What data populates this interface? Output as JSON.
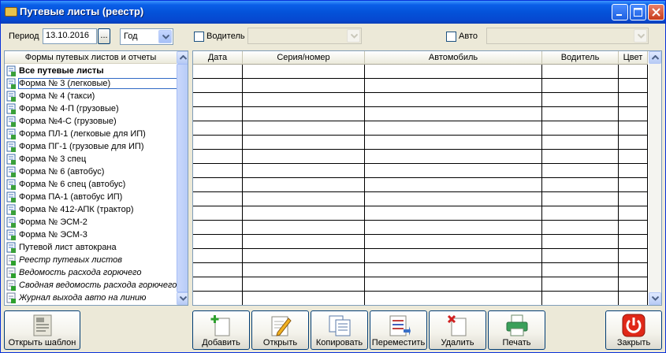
{
  "window": {
    "title": "Путевые листы (реестр)"
  },
  "filters": {
    "period_label": "Период",
    "date_value": "13.10.2016",
    "dots_label": "...",
    "period_type_value": "Год",
    "driver_label": "Водитель",
    "driver_value": "",
    "auto_label": "Авто",
    "auto_value": ""
  },
  "left_panel": {
    "header": "Формы путевых листов и отчеты",
    "items": [
      {
        "label": "Все путевые листы"
      },
      {
        "label": "Форма № 3 (легковые)"
      },
      {
        "label": "Форма № 4 (такси)"
      },
      {
        "label": "Форма № 4-П (грузовые)"
      },
      {
        "label": "Форма №4-С (грузовые)"
      },
      {
        "label": "Форма ПЛ-1 (легковые для ИП)"
      },
      {
        "label": "Форма ПГ-1 (грузовые для ИП)"
      },
      {
        "label": "Форма № 3 спец"
      },
      {
        "label": "Форма № 6 (автобус)"
      },
      {
        "label": "Форма № 6 спец (автобус)"
      },
      {
        "label": "Форма ПА-1 (автобус ИП)"
      },
      {
        "label": "Форма № 412-АПК (трактор)"
      },
      {
        "label": "Форма № ЭСМ-2"
      },
      {
        "label": "Форма № ЭСМ-3"
      },
      {
        "label": "Путевой лист автокрана"
      },
      {
        "label": "Реестр путевых листов"
      },
      {
        "label": "Ведомость расхода горючего"
      },
      {
        "label": "Сводная ведомость расхода горючего"
      },
      {
        "label": "Журнал выхода авто на линию"
      }
    ]
  },
  "grid": {
    "columns": [
      "Дата",
      "Серия/номер",
      "Автомобиль",
      "Водитель",
      "Цвет"
    ]
  },
  "toolbar": {
    "open_template": "Открыть шаблон",
    "add": "Добавить",
    "open": "Открыть",
    "copy": "Копировать",
    "move": "Переместить",
    "delete": "Удалить",
    "print": "Печать",
    "close": "Закрыть"
  },
  "colors": {
    "titlebar": "#0452d9",
    "selection_outline": "#316ac5",
    "window_bg": "#ece9d8"
  }
}
